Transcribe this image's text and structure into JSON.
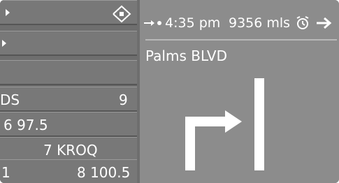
{
  "menu": {
    "items": [
      {
        "label": "",
        "value": "",
        "icon": "play-arrow-icon"
      },
      {
        "label": "",
        "value": "",
        "icon": "play-arrow-icon"
      },
      {
        "label": "",
        "value": ""
      },
      {
        "label": "DS",
        "value": "9"
      },
      {
        "label": "6 97.5",
        "value": ""
      },
      {
        "label": "7 KROQ",
        "value": ""
      },
      {
        "label": "1",
        "value": "8 100.5"
      }
    ],
    "nav_icon": "directional-pad-icon"
  },
  "status": {
    "time": "4:35 pm",
    "distance": "9356 mls",
    "icons": [
      "route-arrow-icon",
      "alarm-clock-icon",
      "arrow-right-icon"
    ]
  },
  "guidance": {
    "street": "Palms BLVD",
    "maneuver": "turn-right-icon"
  },
  "colors": {
    "background": "#8a8a8a",
    "menu_row": "#787878",
    "text": "#ffffff"
  }
}
